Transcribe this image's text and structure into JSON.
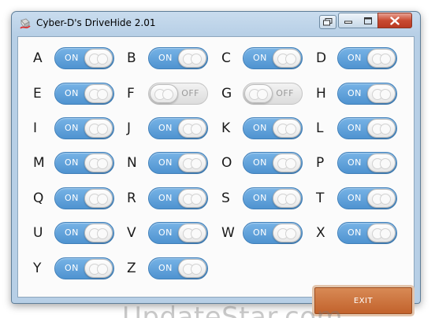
{
  "window": {
    "title": "Cyber-D's DriveHide 2.01"
  },
  "drives": [
    {
      "letter": "A",
      "state": "ON"
    },
    {
      "letter": "B",
      "state": "ON"
    },
    {
      "letter": "C",
      "state": "ON"
    },
    {
      "letter": "D",
      "state": "ON"
    },
    {
      "letter": "E",
      "state": "ON"
    },
    {
      "letter": "F",
      "state": "OFF"
    },
    {
      "letter": "G",
      "state": "OFF"
    },
    {
      "letter": "H",
      "state": "ON"
    },
    {
      "letter": "I",
      "state": "ON"
    },
    {
      "letter": "J",
      "state": "ON"
    },
    {
      "letter": "K",
      "state": "ON"
    },
    {
      "letter": "L",
      "state": "ON"
    },
    {
      "letter": "M",
      "state": "ON"
    },
    {
      "letter": "N",
      "state": "ON"
    },
    {
      "letter": "O",
      "state": "ON"
    },
    {
      "letter": "P",
      "state": "ON"
    },
    {
      "letter": "Q",
      "state": "ON"
    },
    {
      "letter": "R",
      "state": "ON"
    },
    {
      "letter": "S",
      "state": "ON"
    },
    {
      "letter": "T",
      "state": "ON"
    },
    {
      "letter": "U",
      "state": "ON"
    },
    {
      "letter": "V",
      "state": "ON"
    },
    {
      "letter": "W",
      "state": "ON"
    },
    {
      "letter": "X",
      "state": "ON"
    },
    {
      "letter": "Y",
      "state": "ON"
    },
    {
      "letter": "Z",
      "state": "ON"
    }
  ],
  "exit_label": "EXIT",
  "watermark": "UpdateStar.com",
  "icons": {
    "app": "drive-icon",
    "restore": "restore-icon",
    "minimize": "minimize-icon",
    "maximize": "maximize-icon",
    "close": "close-icon"
  }
}
